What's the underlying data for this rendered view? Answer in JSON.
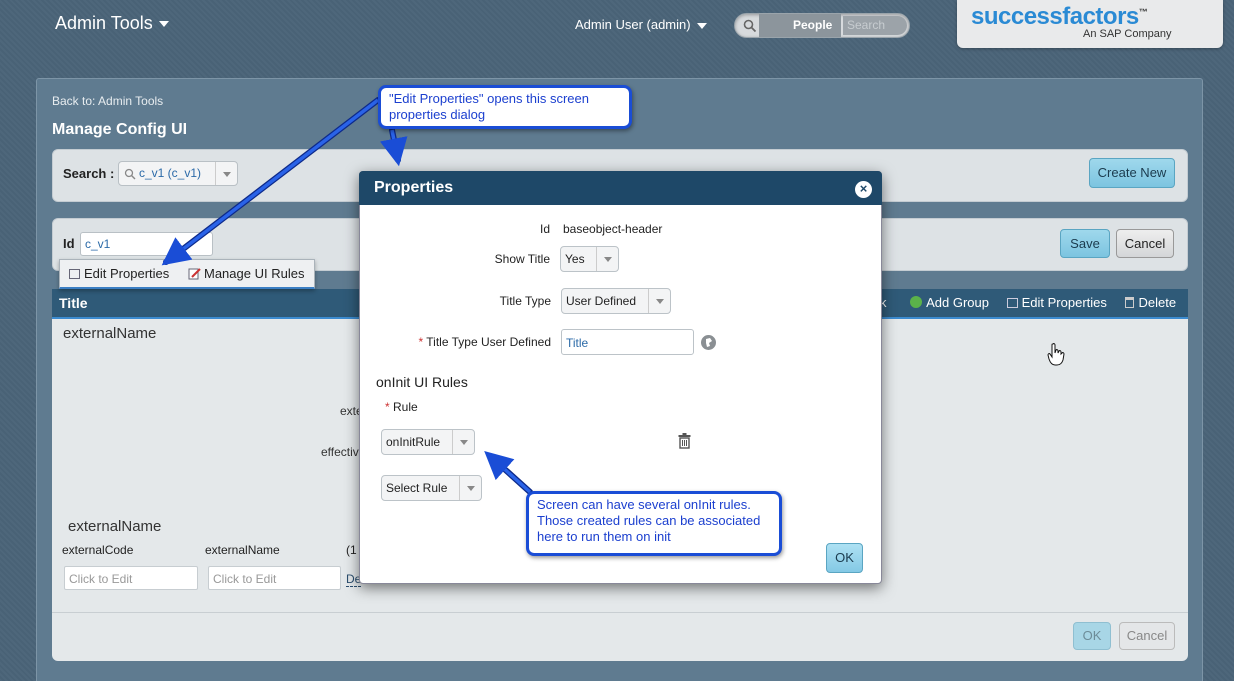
{
  "header": {
    "app_title": "Admin Tools",
    "user_menu": "Admin User (admin)",
    "search_scope": "People",
    "search_placeholder": "Search",
    "brand": "successfactors",
    "brand_tm": "™",
    "brand_sub": "An SAP Company"
  },
  "page": {
    "back_link": "Back to: Admin Tools",
    "title": "Manage Config UI"
  },
  "search_bar": {
    "label": "Search :",
    "value": "c_v1 (c_v1)",
    "create_new": "Create New"
  },
  "id_bar": {
    "label": "Id",
    "value": "c_v1",
    "save": "Save",
    "cancel": "Cancel"
  },
  "popover_menu": {
    "edit_properties": "Edit Properties",
    "manage_ui_rules": "Manage UI Rules"
  },
  "content": {
    "header_title": "Title",
    "actions": {
      "link_fragment": "k",
      "add_group": "Add Group",
      "edit_properties": "Edit Properties",
      "delete": "Delete"
    },
    "external_name_1": "externalName",
    "cut_label_1": "exte",
    "cut_label_2": "effectiv",
    "external_name_2": "externalName",
    "columns": [
      "externalCode",
      "externalName",
      "(1"
    ],
    "cell_placeholder": "Click to Edit",
    "de_link": "De",
    "ok": "OK",
    "cancel": "Cancel"
  },
  "modal": {
    "title": "Properties",
    "close": "×",
    "id_label": "Id",
    "id_value": "baseobject-header",
    "show_title_label": "Show Title",
    "show_title_value": "Yes",
    "title_type_label": "Title Type",
    "title_type_value": "User Defined",
    "title_type_ud_label": "Title Type User Defined",
    "title_type_ud_value": "Title",
    "section_oninit": "onInit UI Rules",
    "rule_label": "Rule",
    "oninit_rule_value": "onInitRule",
    "select_rule_value": "Select Rule",
    "ok": "OK"
  },
  "callouts": {
    "edit_properties": "\"Edit Properties\" opens this screen properties dialog",
    "oninit": "Screen can have several onInit rules. Those created rules can be associated here to run them on init"
  },
  "colors": {
    "accent": "#1a4dd6",
    "header_bg": "#1e4868",
    "button_primary": "#7cc4e0"
  }
}
